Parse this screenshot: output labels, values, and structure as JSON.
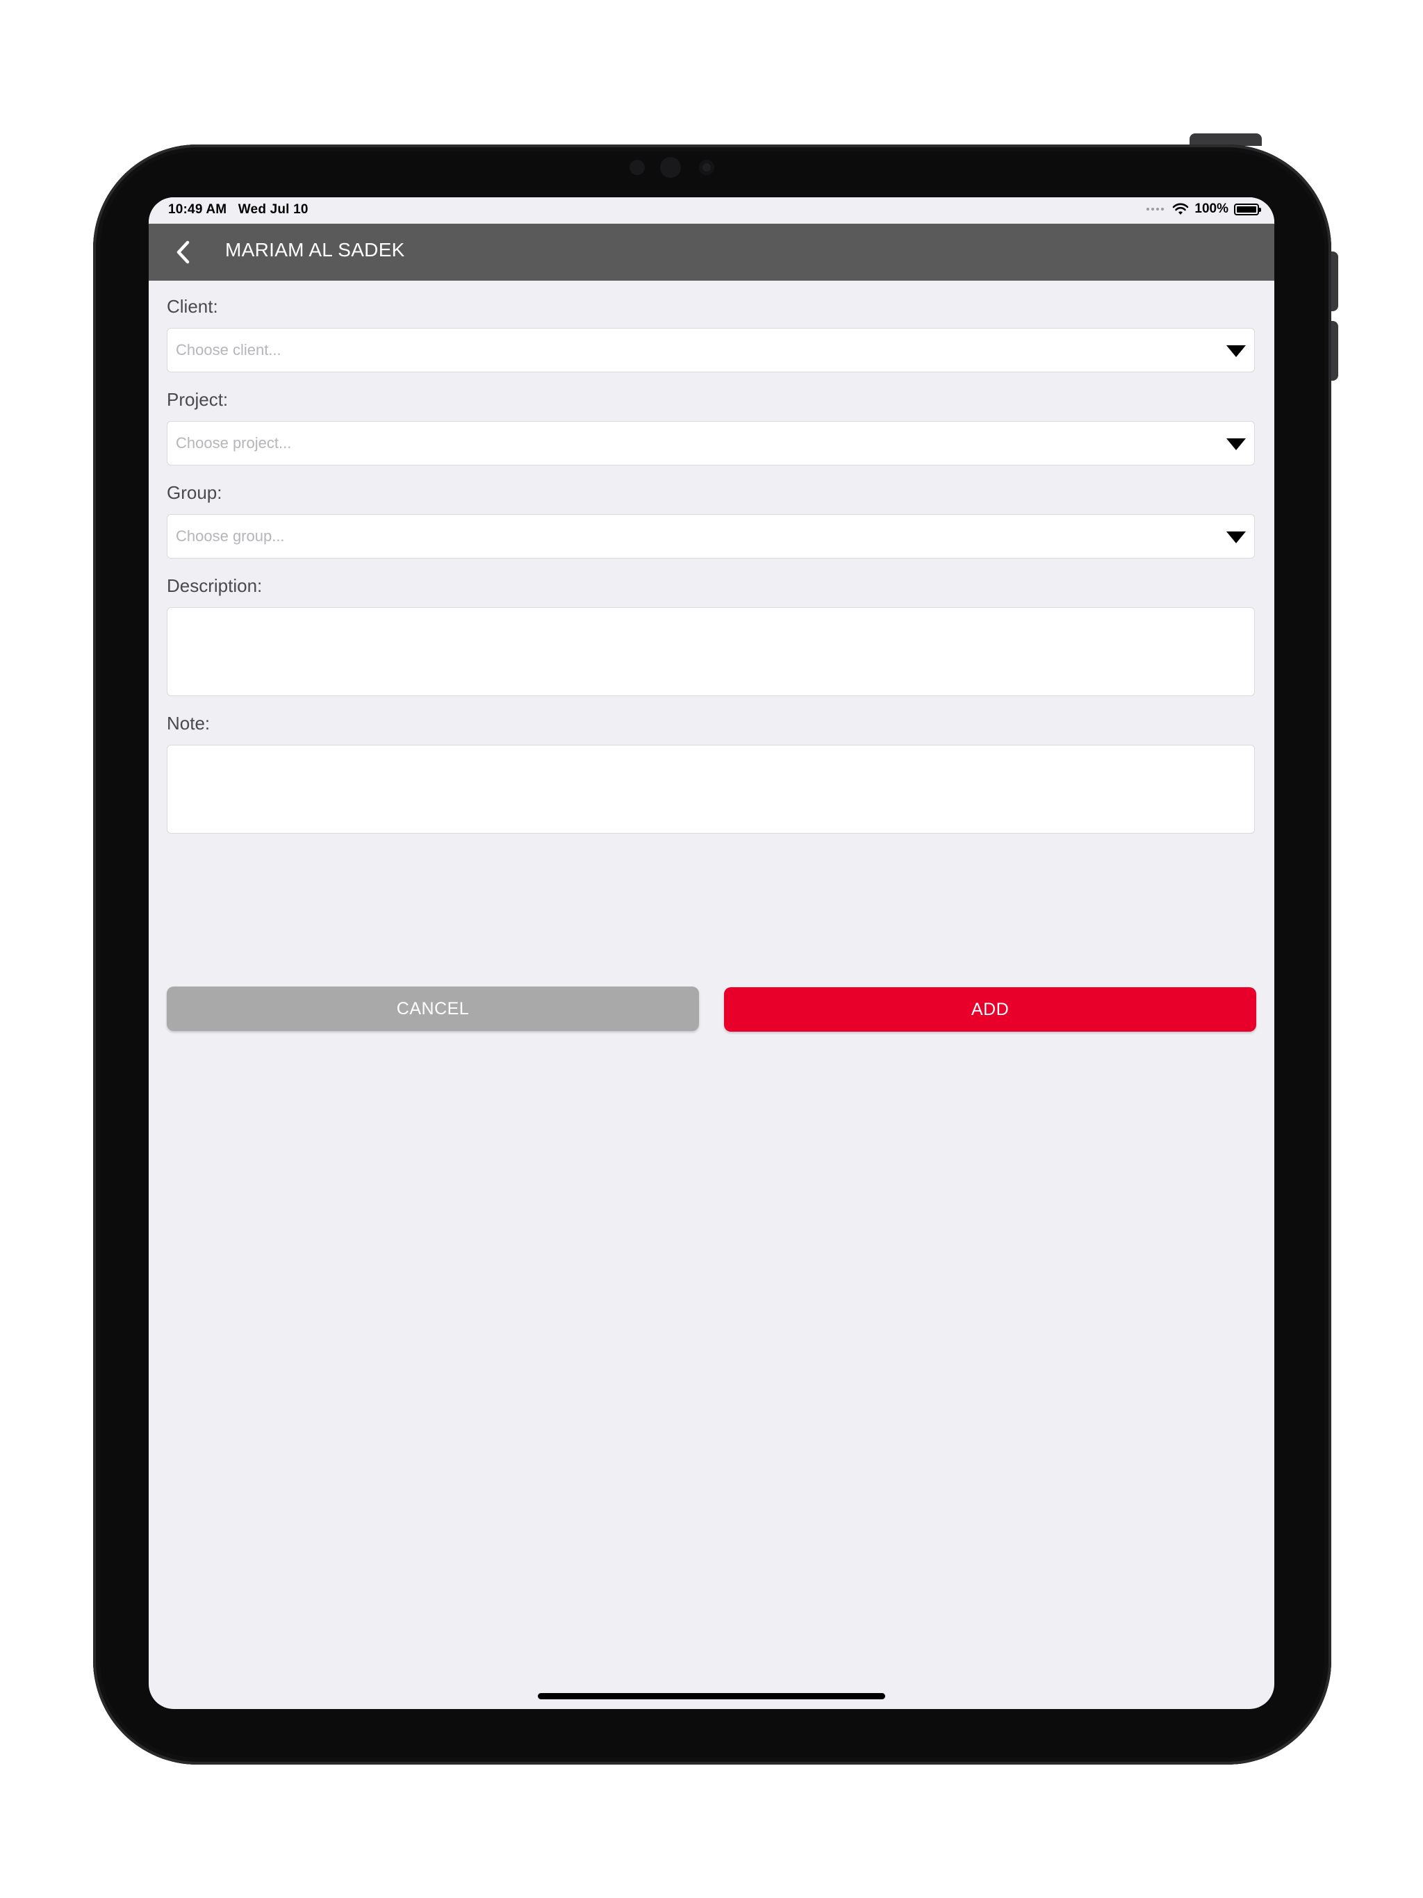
{
  "status_bar": {
    "time": "10:49 AM",
    "date": "Wed Jul 10",
    "battery": "100%",
    "icons": [
      "cellular-dots-icon",
      "wifi-icon",
      "battery-icon"
    ]
  },
  "nav": {
    "title": "MARIAM AL SADEK",
    "back_icon": "chevron-left-icon"
  },
  "form": {
    "client": {
      "label": "Client:",
      "placeholder": "Choose client..."
    },
    "project": {
      "label": "Project:",
      "placeholder": "Choose project..."
    },
    "group": {
      "label": "Group:",
      "placeholder": "Choose group..."
    },
    "description": {
      "label": "Description:",
      "value": ""
    },
    "note": {
      "label": "Note:",
      "value": ""
    }
  },
  "actions": {
    "cancel_label": "CANCEL",
    "add_label": "ADD"
  },
  "colors": {
    "nav_background": "#5a5a5a",
    "screen_background": "#efeff4",
    "cancel_button": "#a9a9a9",
    "add_button": "#e8002a"
  }
}
